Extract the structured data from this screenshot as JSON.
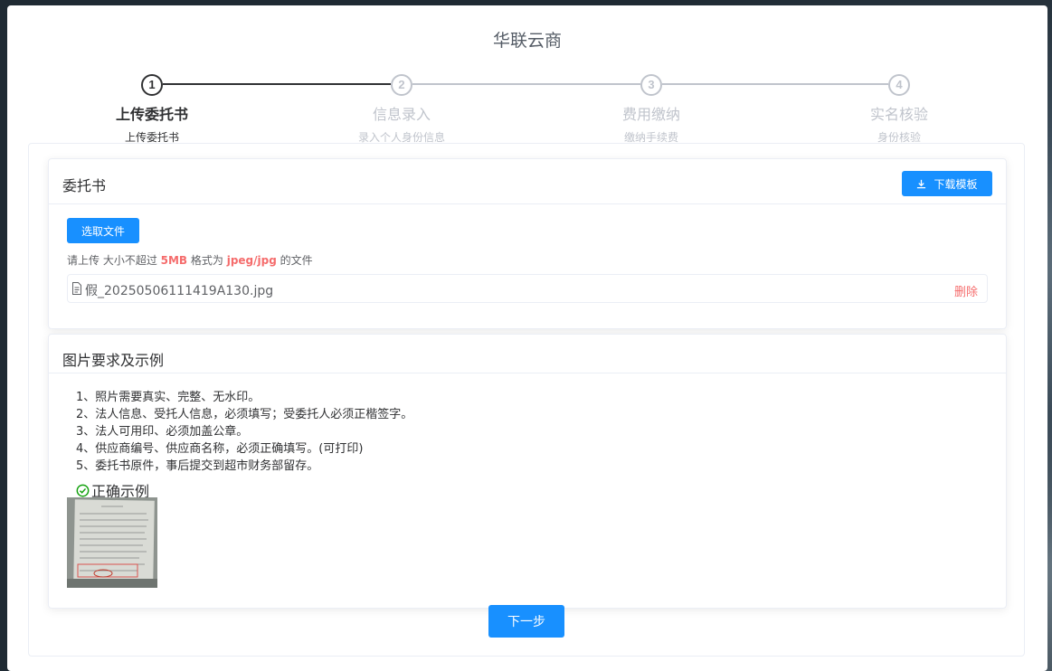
{
  "app": {
    "title": "华联云商"
  },
  "steps": [
    {
      "num": "1",
      "title": "上传委托书",
      "desc": "上传委托书"
    },
    {
      "num": "2",
      "title": "信息录入",
      "desc": "录入个人身份信息"
    },
    {
      "num": "3",
      "title": "费用缴纳",
      "desc": "缴纳手续费"
    },
    {
      "num": "4",
      "title": "实名核验",
      "desc": "身份核验"
    }
  ],
  "upload_card": {
    "title": "委托书",
    "download_label": "下载模板",
    "pick_label": "选取文件",
    "tip_prefix": "请上传 大小不超过 ",
    "tip_size": "5MB",
    "tip_middle": " 格式为 ",
    "tip_format": "jpeg/jpg",
    "tip_suffix": " 的文件",
    "file_name": "假_20250506111419A130.jpg",
    "delete_label": "删除"
  },
  "requirements_card": {
    "title": "图片要求及示例",
    "items": [
      "1、照片需要真实、完整、无水印。",
      "2、法人信息、受托人信息，必须填写；受委托人必须正楷签字。",
      "3、法人可用印、必须加盖公章。",
      "4、供应商编号、供应商名称，必须正确填写。(可打印)",
      "5、委托书原件，事后提交到超市财务部留存。"
    ],
    "example_label": "正确示例"
  },
  "next_label": "下一步",
  "colors": {
    "primary": "#1890ff",
    "danger": "#f56c6c",
    "success": "#13a10e"
  },
  "active_step": 1
}
